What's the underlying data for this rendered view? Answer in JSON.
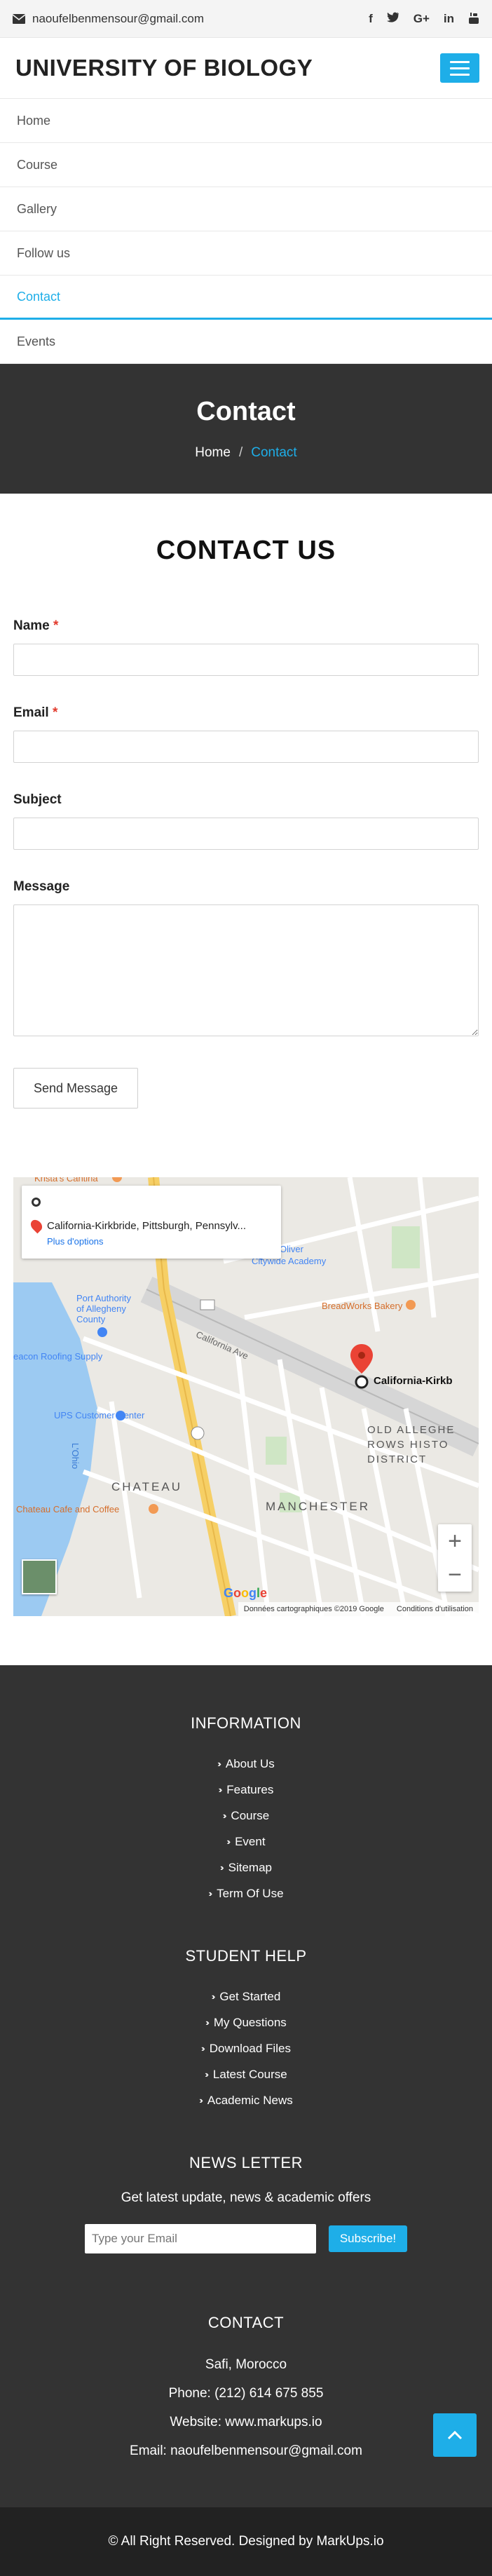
{
  "topbar": {
    "email": "naoufelbenmensour@gmail.com",
    "social_icons": [
      "facebook-icon",
      "twitter-icon",
      "google-plus-icon",
      "linkedin-icon",
      "youtube-icon"
    ]
  },
  "brand": {
    "title": "UNIVERSITY OF BIOLOGY"
  },
  "nav": {
    "items": [
      {
        "label": "Home"
      },
      {
        "label": "Course"
      },
      {
        "label": "Gallery"
      },
      {
        "label": "Follow us"
      },
      {
        "label": "Contact"
      },
      {
        "label": "Events"
      }
    ]
  },
  "hero": {
    "title": "Contact",
    "breadcrumb": {
      "home": "Home",
      "separator": "/",
      "current": "Contact"
    }
  },
  "contact": {
    "heading": "CONTACT US",
    "name_label": "Name",
    "email_label": "Email",
    "subject_label": "Subject",
    "message_label": "Message",
    "required_mark": "*",
    "send_label": "Send Message"
  },
  "map": {
    "place": "California-Kirkbride, Pittsburgh, Pennsylv...",
    "more_options": "Plus d'options",
    "marker_label": "California-Kirkb",
    "labels": {
      "oliver": "Oliver",
      "citywide": "Citywide Academy",
      "port_authority": "Port Authority of Allegheny County",
      "breadworks": "BreadWorks Bakery",
      "beacon": "eacon Roofing Supply",
      "ups": "UPS Customer Center",
      "chateau": "CHATEAU",
      "chateau_cafe": "Chateau Cafe and Coffee",
      "manchester": "MANCHESTER",
      "old_allegheny": "OLD ALLEGHE ROWS HISTO DISTRICT",
      "california_ave": "California Ave",
      "krista": "Krista's Cantina",
      "lohio": "L'Ohio"
    },
    "zoom_in": "+",
    "zoom_out": "−",
    "data_credit": "Données cartographiques ©2019 Google",
    "terms": "Conditions d'utilisation",
    "google": [
      "G",
      "o",
      "o",
      "g",
      "l",
      "e"
    ]
  },
  "footer": {
    "information_title": "INFORMATION",
    "information": [
      "About Us",
      "Features",
      "Course",
      "Event",
      "Sitemap",
      "Term Of Use"
    ],
    "student_title": "STUDENT HELP",
    "student": [
      "Get Started",
      "My Questions",
      "Download Files",
      "Latest Course",
      "Academic News"
    ],
    "newsletter_title": "NEWS LETTER",
    "newsletter_sub": "Get latest update, news & academic offers",
    "newsletter_placeholder": "Type your Email",
    "subscribe_label": "Subscribe!",
    "contact_title": "CONTACT",
    "city": "Safi, Morocco",
    "phone": "Phone: (212) 614 675 855",
    "website": "Website: www.markups.io",
    "email": "Email: naoufelbenmensour@gmail.com",
    "copyright": "© All Right Reserved. Designed by MarkUps.io"
  }
}
